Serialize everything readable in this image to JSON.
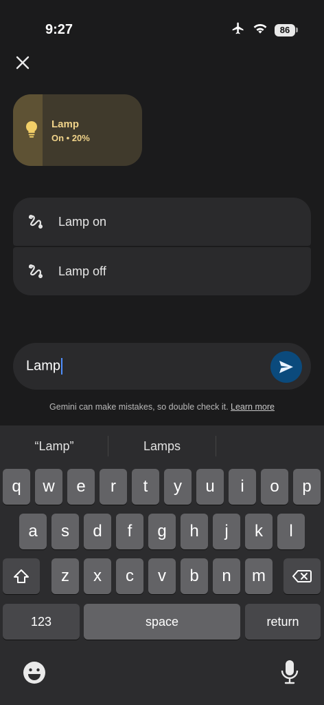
{
  "status_bar": {
    "time": "9:27",
    "battery": "86"
  },
  "device": {
    "name": "Lamp",
    "status": "On • 20%"
  },
  "suggestions": [
    {
      "label": "Lamp on"
    },
    {
      "label": "Lamp off"
    }
  ],
  "input": {
    "value": "Lamp"
  },
  "disclaimer": {
    "text": "Gemini can make mistakes, so double check it.",
    "link": "Learn more"
  },
  "keyboard": {
    "predictions": [
      "“Lamp”",
      "Lamps"
    ],
    "row1": [
      "q",
      "w",
      "e",
      "r",
      "t",
      "y",
      "u",
      "i",
      "o",
      "p"
    ],
    "row2": [
      "a",
      "s",
      "d",
      "f",
      "g",
      "h",
      "j",
      "k",
      "l"
    ],
    "row3": [
      "z",
      "x",
      "c",
      "v",
      "b",
      "n",
      "m"
    ],
    "numbers_label": "123",
    "space_label": "space",
    "return_label": "return"
  },
  "colors": {
    "background": "#1b1b1c",
    "accent": "#0b4a7c",
    "lamp_text": "#f0d38a"
  },
  "icons": [
    "airplane-icon",
    "wifi-icon",
    "battery-icon",
    "close-icon",
    "lightbulb-icon",
    "routine-icon",
    "send-icon",
    "shift-icon",
    "backspace-icon",
    "emoji-icon",
    "microphone-icon"
  ]
}
